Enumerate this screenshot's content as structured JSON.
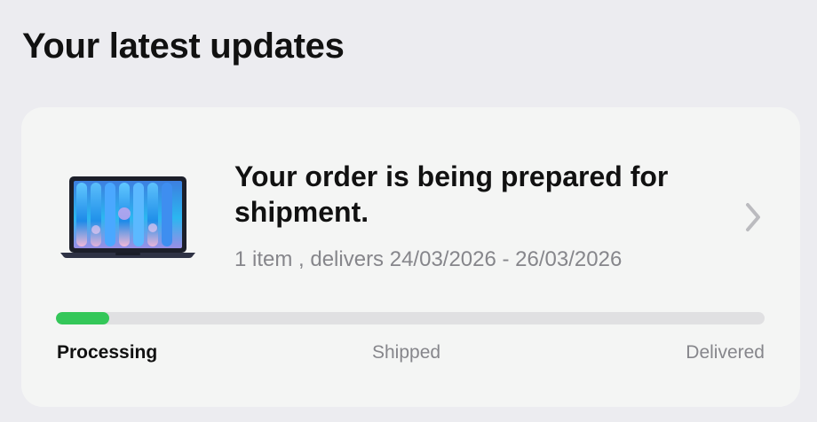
{
  "section": {
    "title": "Your latest updates"
  },
  "order_card": {
    "headline": "Your order is being prepared for shipment.",
    "subline": "1 item , delivers 24/03/2026 - 26/03/2026",
    "product_image": "laptop-image",
    "chevron_icon": "chevron-right-icon",
    "progress": {
      "fraction": 0.075,
      "color": "#34c759"
    },
    "steps": [
      {
        "label": "Processing",
        "active": true
      },
      {
        "label": "Shipped",
        "active": false
      },
      {
        "label": "Delivered",
        "active": false
      }
    ]
  }
}
